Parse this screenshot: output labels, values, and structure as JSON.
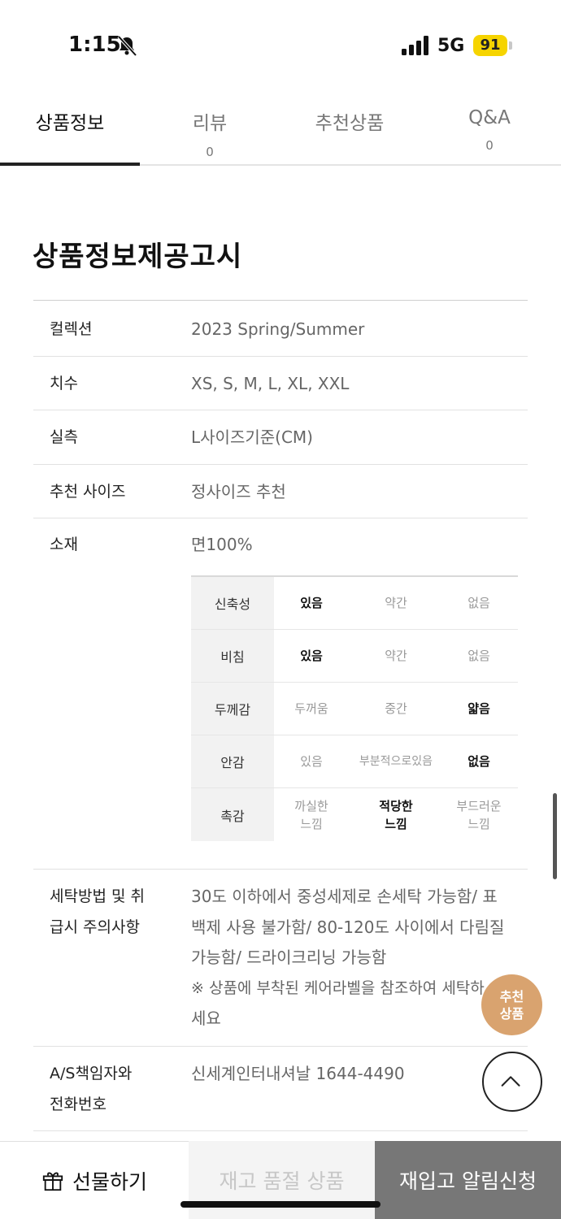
{
  "status_bar": {
    "time": "1:15",
    "network": "5G",
    "battery": "91"
  },
  "tabs": [
    {
      "label": "상품정보",
      "count": ""
    },
    {
      "label": "리뷰",
      "count": "0"
    },
    {
      "label": "추천상품",
      "count": ""
    },
    {
      "label": "Q&A",
      "count": "0"
    }
  ],
  "section_title": "상품정보제공고시",
  "info": {
    "collection": {
      "label": "컬렉션",
      "value": "2023 Spring/Summer"
    },
    "size": {
      "label": "치수",
      "value": "XS, S, M, L, XL, XXL"
    },
    "measure": {
      "label": "실측",
      "value": "L사이즈기준(CM)"
    },
    "recommend_size": {
      "label": "추천 사이즈",
      "value": "정사이즈 추천"
    },
    "material": {
      "label": "소재",
      "value": "면100%"
    },
    "washing": {
      "label_line1": "세탁방법 및 취",
      "label_line2": "급시 주의사항",
      "line1": "30도 이하에서 중성세제로 손세탁 가능함/ 표",
      "line2": "백제 사용 불가함/ 80-120도 사이에서 다림질",
      "line3": "가능함/ 드라이크리닝 가능함",
      "line4": "※ 상품에 부착된 케어라벨을 참조하여 세탁하",
      "line5": "세요"
    },
    "as": {
      "label_line1": "A/S책임자와",
      "label_line2": "전화번호",
      "value": "신세계인터내셔날 1644-4490"
    }
  },
  "fabric": [
    {
      "attr": "신축성",
      "opts": [
        "있음",
        "약간",
        "없음"
      ],
      "selected": 0
    },
    {
      "attr": "비침",
      "opts": [
        "있음",
        "약간",
        "없음"
      ],
      "selected": 0
    },
    {
      "attr": "두께감",
      "opts": [
        "두꺼움",
        "중간",
        "얇음"
      ],
      "selected": 2
    },
    {
      "attr": "안감",
      "opts": [
        "있음",
        "부분적으로있음",
        "없음"
      ],
      "selected": 2
    },
    {
      "attr": "촉감",
      "opts": [
        "까실한\n느낌",
        "적당한\n느낌",
        "부드러운\n느낌"
      ],
      "selected": 1
    }
  ],
  "recommend_fab": {
    "line1": "추천",
    "line2": "상품"
  },
  "bottom": {
    "gift": "선물하기",
    "soldout": "재고 품절 상품",
    "restock": "재입고 알림신청"
  }
}
